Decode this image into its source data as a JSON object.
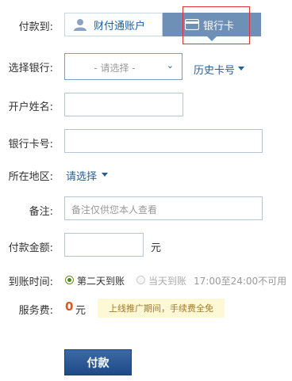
{
  "form": {
    "labels": {
      "payee": "付款到:",
      "bank": "选择银行:",
      "name": "开户姓名:",
      "card": "银行卡号:",
      "region": "所在地区:",
      "note": "备注:",
      "amount": "付款金额:",
      "time": "到账时间:",
      "fee": "服务费:"
    },
    "tabs": {
      "account": "财付通账户",
      "bank_card": "银行卡"
    },
    "bank_select": {
      "placeholder": "- 请选择 -",
      "history_link": "历史卡号"
    },
    "region_select": "请选择",
    "note_placeholder": "备注仅供您本人查看",
    "amount_unit": "元",
    "arrival": {
      "option1": "第二天到账",
      "option2": "当天到账",
      "option2_note": "17:00至24:00不可用"
    },
    "fee": {
      "amount": "0",
      "unit": "元",
      "promo": "上线推广期间，手续费全免"
    },
    "submit": "付款"
  },
  "colors": {
    "accent": "#2a5f96",
    "tab_active": "#6e8fb6",
    "fee_highlight": "#e4571a",
    "button": "#2a5a96"
  }
}
